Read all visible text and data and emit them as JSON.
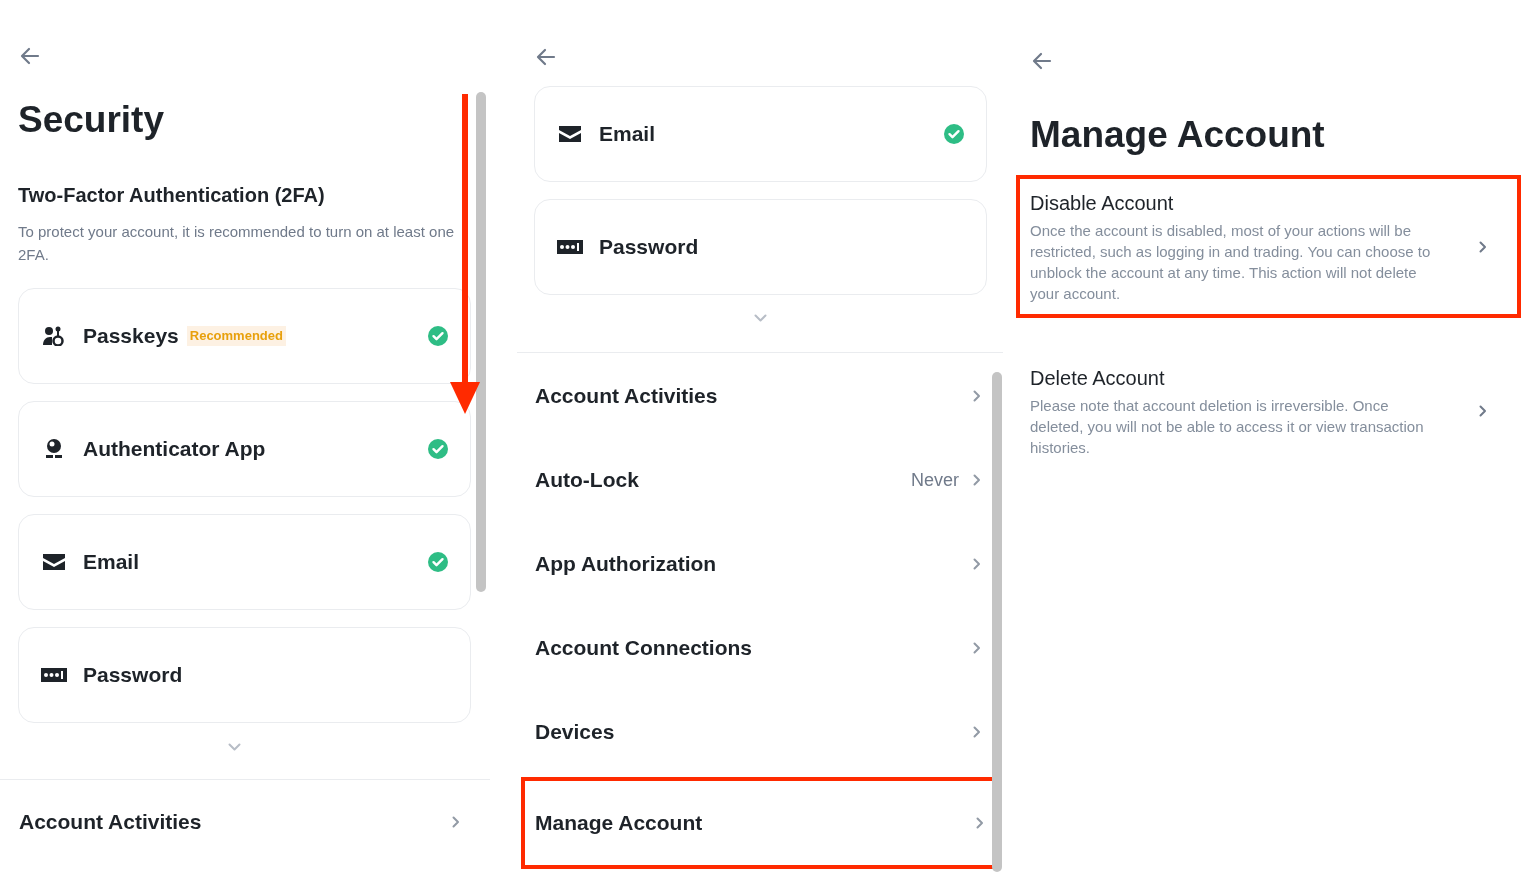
{
  "security_screen": {
    "title": "Security",
    "section_title": "Two-Factor Authentication (2FA)",
    "section_description": "To protect your account, it is recommended to turn on at least one 2FA.",
    "scroll_arrow": true,
    "methods": [
      {
        "kind": "passkeys",
        "label": "Passkeys",
        "badge": "Recommended",
        "verified": true
      },
      {
        "kind": "authenticator",
        "label": "Authenticator App",
        "verified": true
      },
      {
        "kind": "email",
        "label": "Email",
        "verified": true
      },
      {
        "kind": "password",
        "label": "Password",
        "verified": false
      }
    ],
    "menu": [
      {
        "label": "Account Activities",
        "highlighted": false
      }
    ]
  },
  "security_screen_scrolled": {
    "methods": [
      {
        "kind": "email",
        "label": "Email",
        "verified": true
      },
      {
        "kind": "password",
        "label": "Password",
        "verified": false
      }
    ],
    "menu": [
      {
        "label": "Account Activities",
        "highlighted": false
      },
      {
        "label": "Auto-Lock",
        "value": "Never",
        "highlighted": false
      },
      {
        "label": "App Authorization",
        "highlighted": false
      },
      {
        "label": "Account Connections",
        "highlighted": false
      },
      {
        "label": "Devices",
        "highlighted": false
      },
      {
        "label": "Manage Account",
        "highlighted": true
      }
    ]
  },
  "manage_account_screen": {
    "title": "Manage Account",
    "options": [
      {
        "title": "Disable Account",
        "description": "Once the account is disabled, most of your actions will be restricted, such as logging in and trading. You can choose to unblock the account at any time. This action will not delete your account.",
        "highlighted": true
      },
      {
        "title": "Delete Account",
        "description": "Please note that account deletion is irreversible. Once deleted, you will not be able to access it or view transaction histories.",
        "highlighted": false
      }
    ]
  }
}
